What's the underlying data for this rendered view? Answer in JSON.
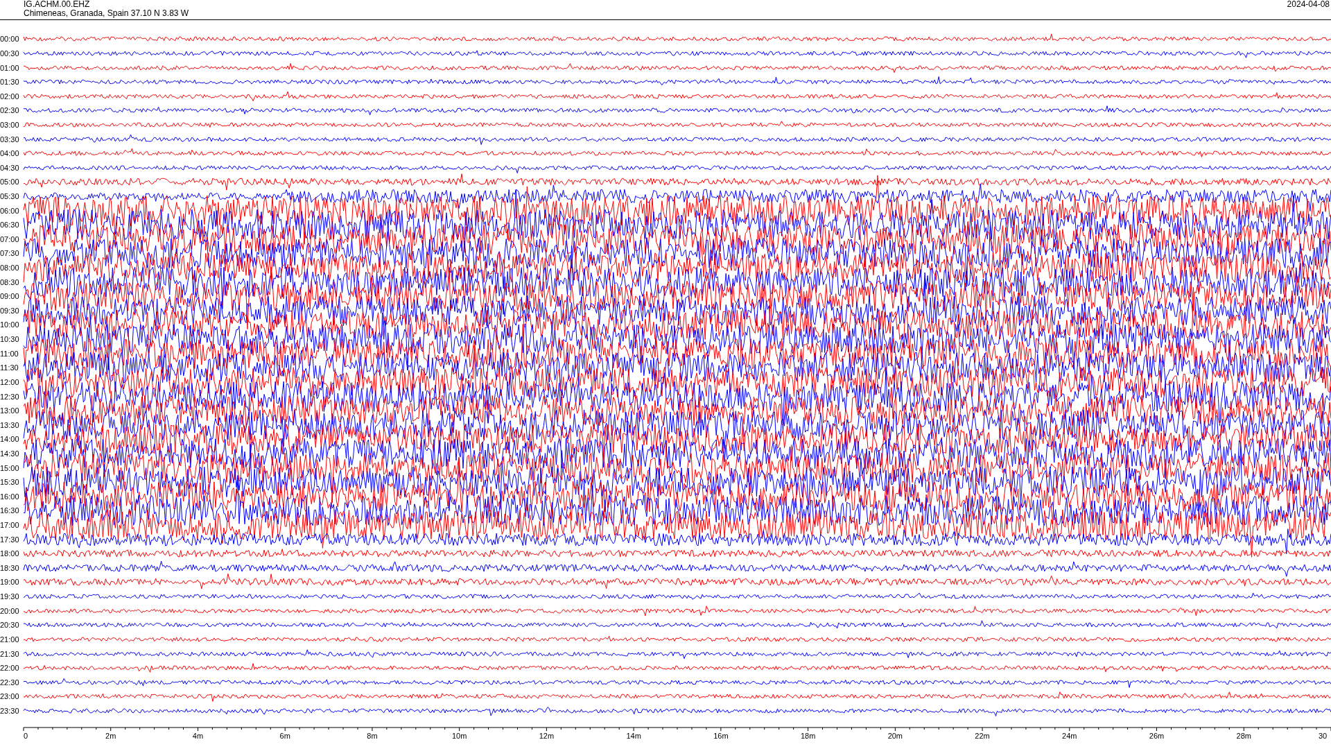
{
  "header": {
    "station": "IG.ACHM.00.EHZ",
    "location": "Chimeneas, Granada, Spain  37.10 N 3.83 W",
    "date": "2024-04-08"
  },
  "rows": [
    {
      "time": "00:00",
      "color": "#ff0000"
    },
    {
      "time": "00:30",
      "color": "#0000ff"
    },
    {
      "time": "01:00",
      "color": "#ff0000"
    },
    {
      "time": "01:30",
      "color": "#0000ff"
    },
    {
      "time": "02:00",
      "color": "#ff0000"
    },
    {
      "time": "02:30",
      "color": "#0000ff"
    },
    {
      "time": "03:00",
      "color": "#ff0000"
    },
    {
      "time": "03:30",
      "color": "#0000ff"
    },
    {
      "time": "04:00",
      "color": "#ff0000"
    },
    {
      "time": "04:30",
      "color": "#0000ff"
    },
    {
      "time": "05:00",
      "color": "#ff0000"
    },
    {
      "time": "05:30",
      "color": "#0000ff"
    },
    {
      "time": "06:00",
      "color": "#ff0000"
    },
    {
      "time": "06:30",
      "color": "#0000ff"
    },
    {
      "time": "07:00",
      "color": "#ff0000"
    },
    {
      "time": "07:30",
      "color": "#0000ff"
    },
    {
      "time": "08:00",
      "color": "#ff0000"
    },
    {
      "time": "08:30",
      "color": "#0000ff"
    },
    {
      "time": "09:00",
      "color": "#ff0000"
    },
    {
      "time": "09:30",
      "color": "#0000ff"
    },
    {
      "time": "10:00",
      "color": "#ff0000"
    },
    {
      "time": "10:30",
      "color": "#0000ff"
    },
    {
      "time": "11:00",
      "color": "#ff0000"
    },
    {
      "time": "11:30",
      "color": "#0000ff"
    },
    {
      "time": "12:00",
      "color": "#ff0000"
    },
    {
      "time": "12:30",
      "color": "#0000ff"
    },
    {
      "time": "13:00",
      "color": "#ff0000"
    },
    {
      "time": "13:30",
      "color": "#0000ff"
    },
    {
      "time": "14:00",
      "color": "#ff0000"
    },
    {
      "time": "14:30",
      "color": "#0000ff"
    },
    {
      "time": "15:00",
      "color": "#ff0000"
    },
    {
      "time": "15:30",
      "color": "#0000ff"
    },
    {
      "time": "16:00",
      "color": "#ff0000"
    },
    {
      "time": "16:30",
      "color": "#0000ff"
    },
    {
      "time": "17:00",
      "color": "#ff0000"
    },
    {
      "time": "17:30",
      "color": "#0000ff"
    },
    {
      "time": "18:00",
      "color": "#ff0000"
    },
    {
      "time": "18:30",
      "color": "#0000ff"
    },
    {
      "time": "19:00",
      "color": "#ff0000"
    },
    {
      "time": "19:30",
      "color": "#0000ff"
    },
    {
      "time": "20:00",
      "color": "#ff0000"
    },
    {
      "time": "20:30",
      "color": "#0000ff"
    },
    {
      "time": "21:00",
      "color": "#ff0000"
    },
    {
      "time": "21:30",
      "color": "#0000ff"
    },
    {
      "time": "22:00",
      "color": "#ff0000"
    },
    {
      "time": "22:30",
      "color": "#0000ff"
    },
    {
      "time": "23:00",
      "color": "#ff0000"
    },
    {
      "time": "23:30",
      "color": "#0000ff"
    }
  ],
  "axis": {
    "ticks": [
      "0",
      "2m",
      "4m",
      "6m",
      "8m",
      "10m",
      "12m",
      "14m",
      "16m",
      "18m",
      "20m",
      "22m",
      "24m",
      "26m",
      "28m",
      "30"
    ]
  }
}
